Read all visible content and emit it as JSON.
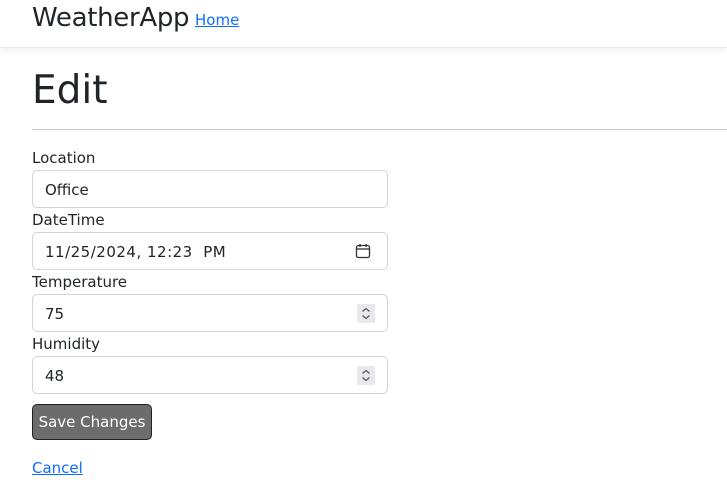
{
  "navbar": {
    "brand": "WeatherApp",
    "home_link": "Home"
  },
  "page": {
    "title": "Edit"
  },
  "form": {
    "location": {
      "label": "Location",
      "value": "Office"
    },
    "datetime": {
      "label": "DateTime",
      "value": "11/25/2024, 12:23  PM",
      "icon": "calendar-icon"
    },
    "temperature": {
      "label": "Temperature",
      "value": "75",
      "icon": "spinner-icon"
    },
    "humidity": {
      "label": "Humidity",
      "value": "48",
      "icon": "spinner-icon"
    },
    "save_label": "Save Changes",
    "cancel_label": "Cancel"
  },
  "colors": {
    "link": "#0d6efd",
    "button_bg": "#6c6c6c",
    "input_border": "#ced4da"
  }
}
